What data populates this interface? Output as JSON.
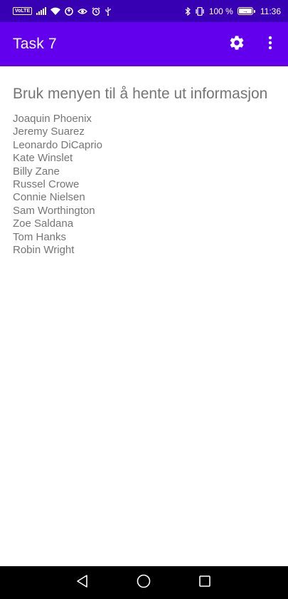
{
  "status_bar": {
    "volte": "VoLTE",
    "battery_percent": "100 %",
    "time": "11:36",
    "icons_left": [
      "volte-icon",
      "signal-icon",
      "wifi-icon",
      "data-saver-icon",
      "eye-icon",
      "alarm-icon",
      "usb-icon"
    ],
    "icons_right": [
      "bluetooth-icon",
      "vibrate-icon",
      "battery-charging-icon"
    ]
  },
  "app_bar": {
    "title": "Task 7",
    "color": "#6200ee",
    "actions": [
      "gear-icon",
      "overflow-menu-icon"
    ]
  },
  "main": {
    "heading": "Bruk menyen til å hente ut informasjon",
    "actors": [
      "Joaquin Phoenix",
      "Jeremy Suarez",
      "Leonardo DiCaprio",
      "Kate Winslet",
      "Billy Zane",
      "Russel Crowe",
      "Connie Nielsen",
      "Sam Worthington",
      "Zoe Saldana",
      "Tom Hanks",
      "Robin Wright"
    ]
  },
  "nav_bar": {
    "buttons": [
      "back-icon",
      "home-icon",
      "recents-icon"
    ]
  },
  "colors": {
    "status_bar": "#3700b3",
    "app_bar": "#6200ee",
    "text_secondary": "#757575"
  }
}
